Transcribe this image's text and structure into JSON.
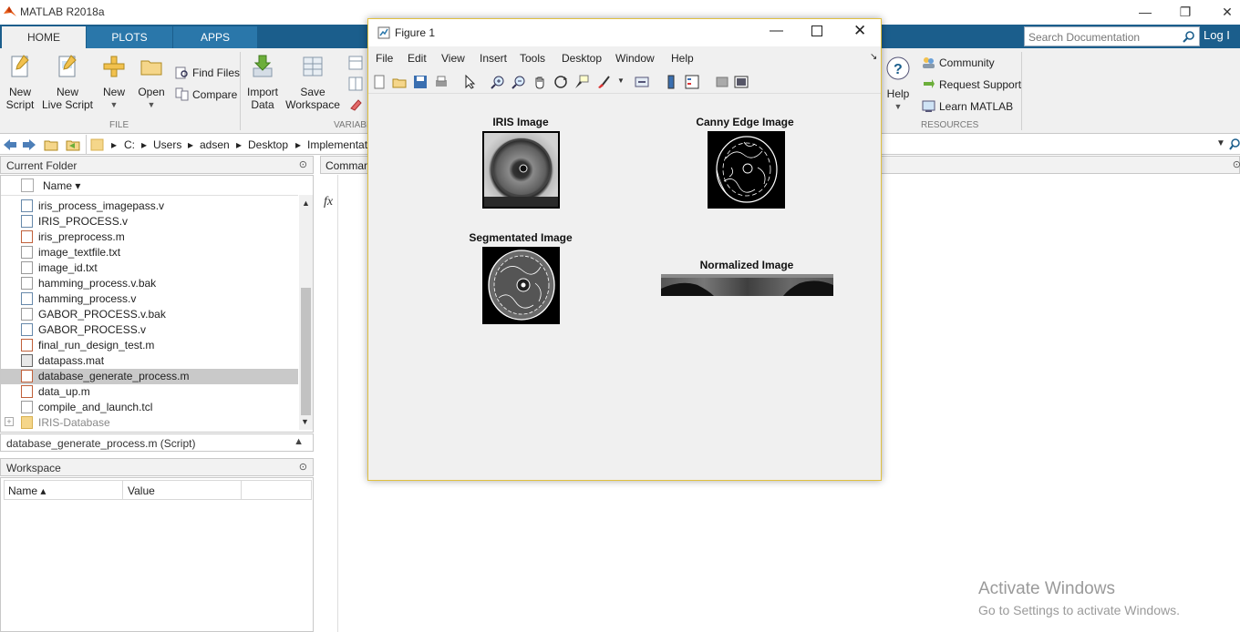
{
  "app": {
    "title": "MATLAB R2018a",
    "window_controls": {
      "minimize": "—",
      "restore": "❐",
      "close": "✕"
    }
  },
  "tabs": [
    {
      "label": "HOME"
    },
    {
      "label": "PLOTS"
    },
    {
      "label": "APPS"
    }
  ],
  "ribbon": {
    "file_group": {
      "label": "FILE",
      "new_script": "New\nScript",
      "new_live_script": "New\nLive Script",
      "new": "New",
      "open": "Open",
      "find_files": "Find Files",
      "compare": "Compare"
    },
    "variable_group": {
      "label": "VARIABL",
      "import_data": "Import\nData",
      "save_workspace": "Save\nWorkspace"
    },
    "resources_group": {
      "label": "RESOURCES",
      "help": "Help",
      "community": "Community",
      "request_support": "Request Support",
      "learn_matlab": "Learn MATLAB"
    }
  },
  "search": {
    "placeholder": "Search Documentation"
  },
  "login": "Log I",
  "address": {
    "parts": [
      "C:",
      "Users",
      "adsen",
      "Desktop",
      "Implementat"
    ]
  },
  "current_folder": {
    "title": "Current Folder",
    "column": "Name ▾",
    "files": [
      {
        "name": "iris_process_imagepass.v",
        "selected": false
      },
      {
        "name": "IRIS_PROCESS.v",
        "selected": false
      },
      {
        "name": "iris_preprocess.m",
        "selected": false
      },
      {
        "name": "image_textfile.txt",
        "selected": false
      },
      {
        "name": "image_id.txt",
        "selected": false
      },
      {
        "name": "hamming_process.v.bak",
        "selected": false
      },
      {
        "name": "hamming_process.v",
        "selected": false
      },
      {
        "name": "GABOR_PROCESS.v.bak",
        "selected": false
      },
      {
        "name": "GABOR_PROCESS.v",
        "selected": false
      },
      {
        "name": "final_run_design_test.m",
        "selected": false
      },
      {
        "name": "datapass.mat",
        "selected": false
      },
      {
        "name": "database_generate_process.m",
        "selected": true
      },
      {
        "name": "data_up.m",
        "selected": false
      },
      {
        "name": "compile_and_launch.tcl",
        "selected": false
      },
      {
        "name": "IRIS-Database",
        "selected": false
      }
    ],
    "details": "database_generate_process.m  (Script)"
  },
  "workspace": {
    "title": "Workspace",
    "columns": [
      "Name ▴",
      "Value"
    ]
  },
  "command_window": {
    "title": "Comman",
    "prompt": "fx"
  },
  "figure": {
    "title": "Figure 1",
    "menus": [
      "File",
      "Edit",
      "View",
      "Insert",
      "Tools",
      "Desktop",
      "Window",
      "Help"
    ],
    "plots": {
      "iris": "IRIS Image",
      "canny": "Canny Edge Image",
      "segmented": "Segmentated Image",
      "normalized": "Normalized Image"
    }
  },
  "watermark": {
    "line1": "Activate Windows",
    "line2": "Go to Settings to activate Windows."
  },
  "colors": {
    "tab_bar": "#1b5e8c",
    "ribbon": "#f0f0f0",
    "selection": "#c9c9c9",
    "figure_border": "#e0c040"
  }
}
